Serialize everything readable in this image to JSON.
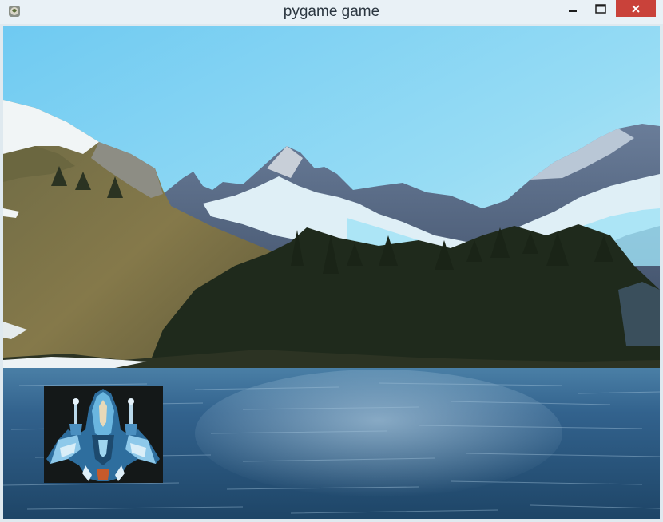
{
  "window": {
    "title": "pygame game",
    "icons": {
      "app": "pygame-snake-icon",
      "minimize": "minimize-icon",
      "maximize": "maximize-icon",
      "close": "close-icon"
    }
  },
  "game": {
    "background": "mountain-lake-landscape",
    "player_sprite": "blue-fighter-spaceship",
    "colors": {
      "sky": "#7fd0f2",
      "water": "#2f5d86",
      "forest": "#1f2a1c",
      "hillside": "#7d7445",
      "snow": "#f2f6f8",
      "close_button": "#c9423a"
    }
  }
}
